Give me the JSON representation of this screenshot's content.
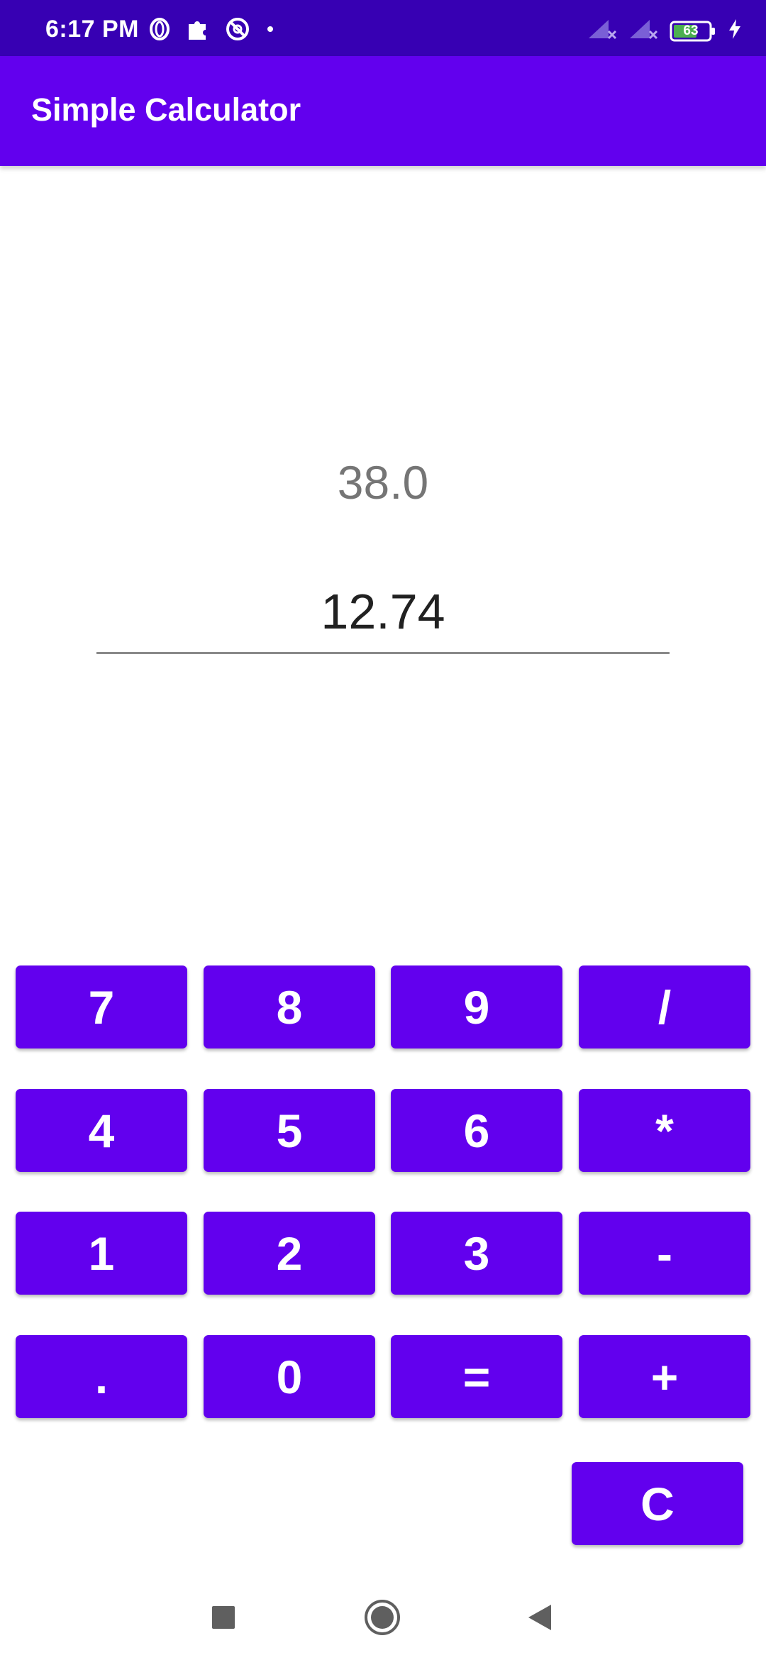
{
  "status_bar": {
    "time": "6:17 PM",
    "battery_level": "63",
    "icons_left": [
      "opera-icon",
      "puzzle-icon",
      "at-sign-icon",
      "dot-icon"
    ],
    "icons_right": [
      "signal-icon",
      "signal-icon",
      "battery-icon",
      "charging-icon"
    ]
  },
  "app_bar": {
    "title": "Simple Calculator"
  },
  "display": {
    "previous_value": "38.0",
    "current_input": "12.74"
  },
  "keypad": {
    "rows": [
      [
        "7",
        "8",
        "9",
        "/"
      ],
      [
        "4",
        "5",
        "6",
        "*"
      ],
      [
        "1",
        "2",
        "3",
        "-"
      ],
      [
        ".",
        "0",
        "=",
        "+"
      ]
    ],
    "clear_label": "C"
  },
  "nav_bar": {
    "buttons": [
      "recents-square-icon",
      "home-circle-icon",
      "back-triangle-icon"
    ]
  },
  "colors": {
    "status_bar": "#3700b3",
    "primary": "#6200ee",
    "key_text": "#ffffff"
  }
}
